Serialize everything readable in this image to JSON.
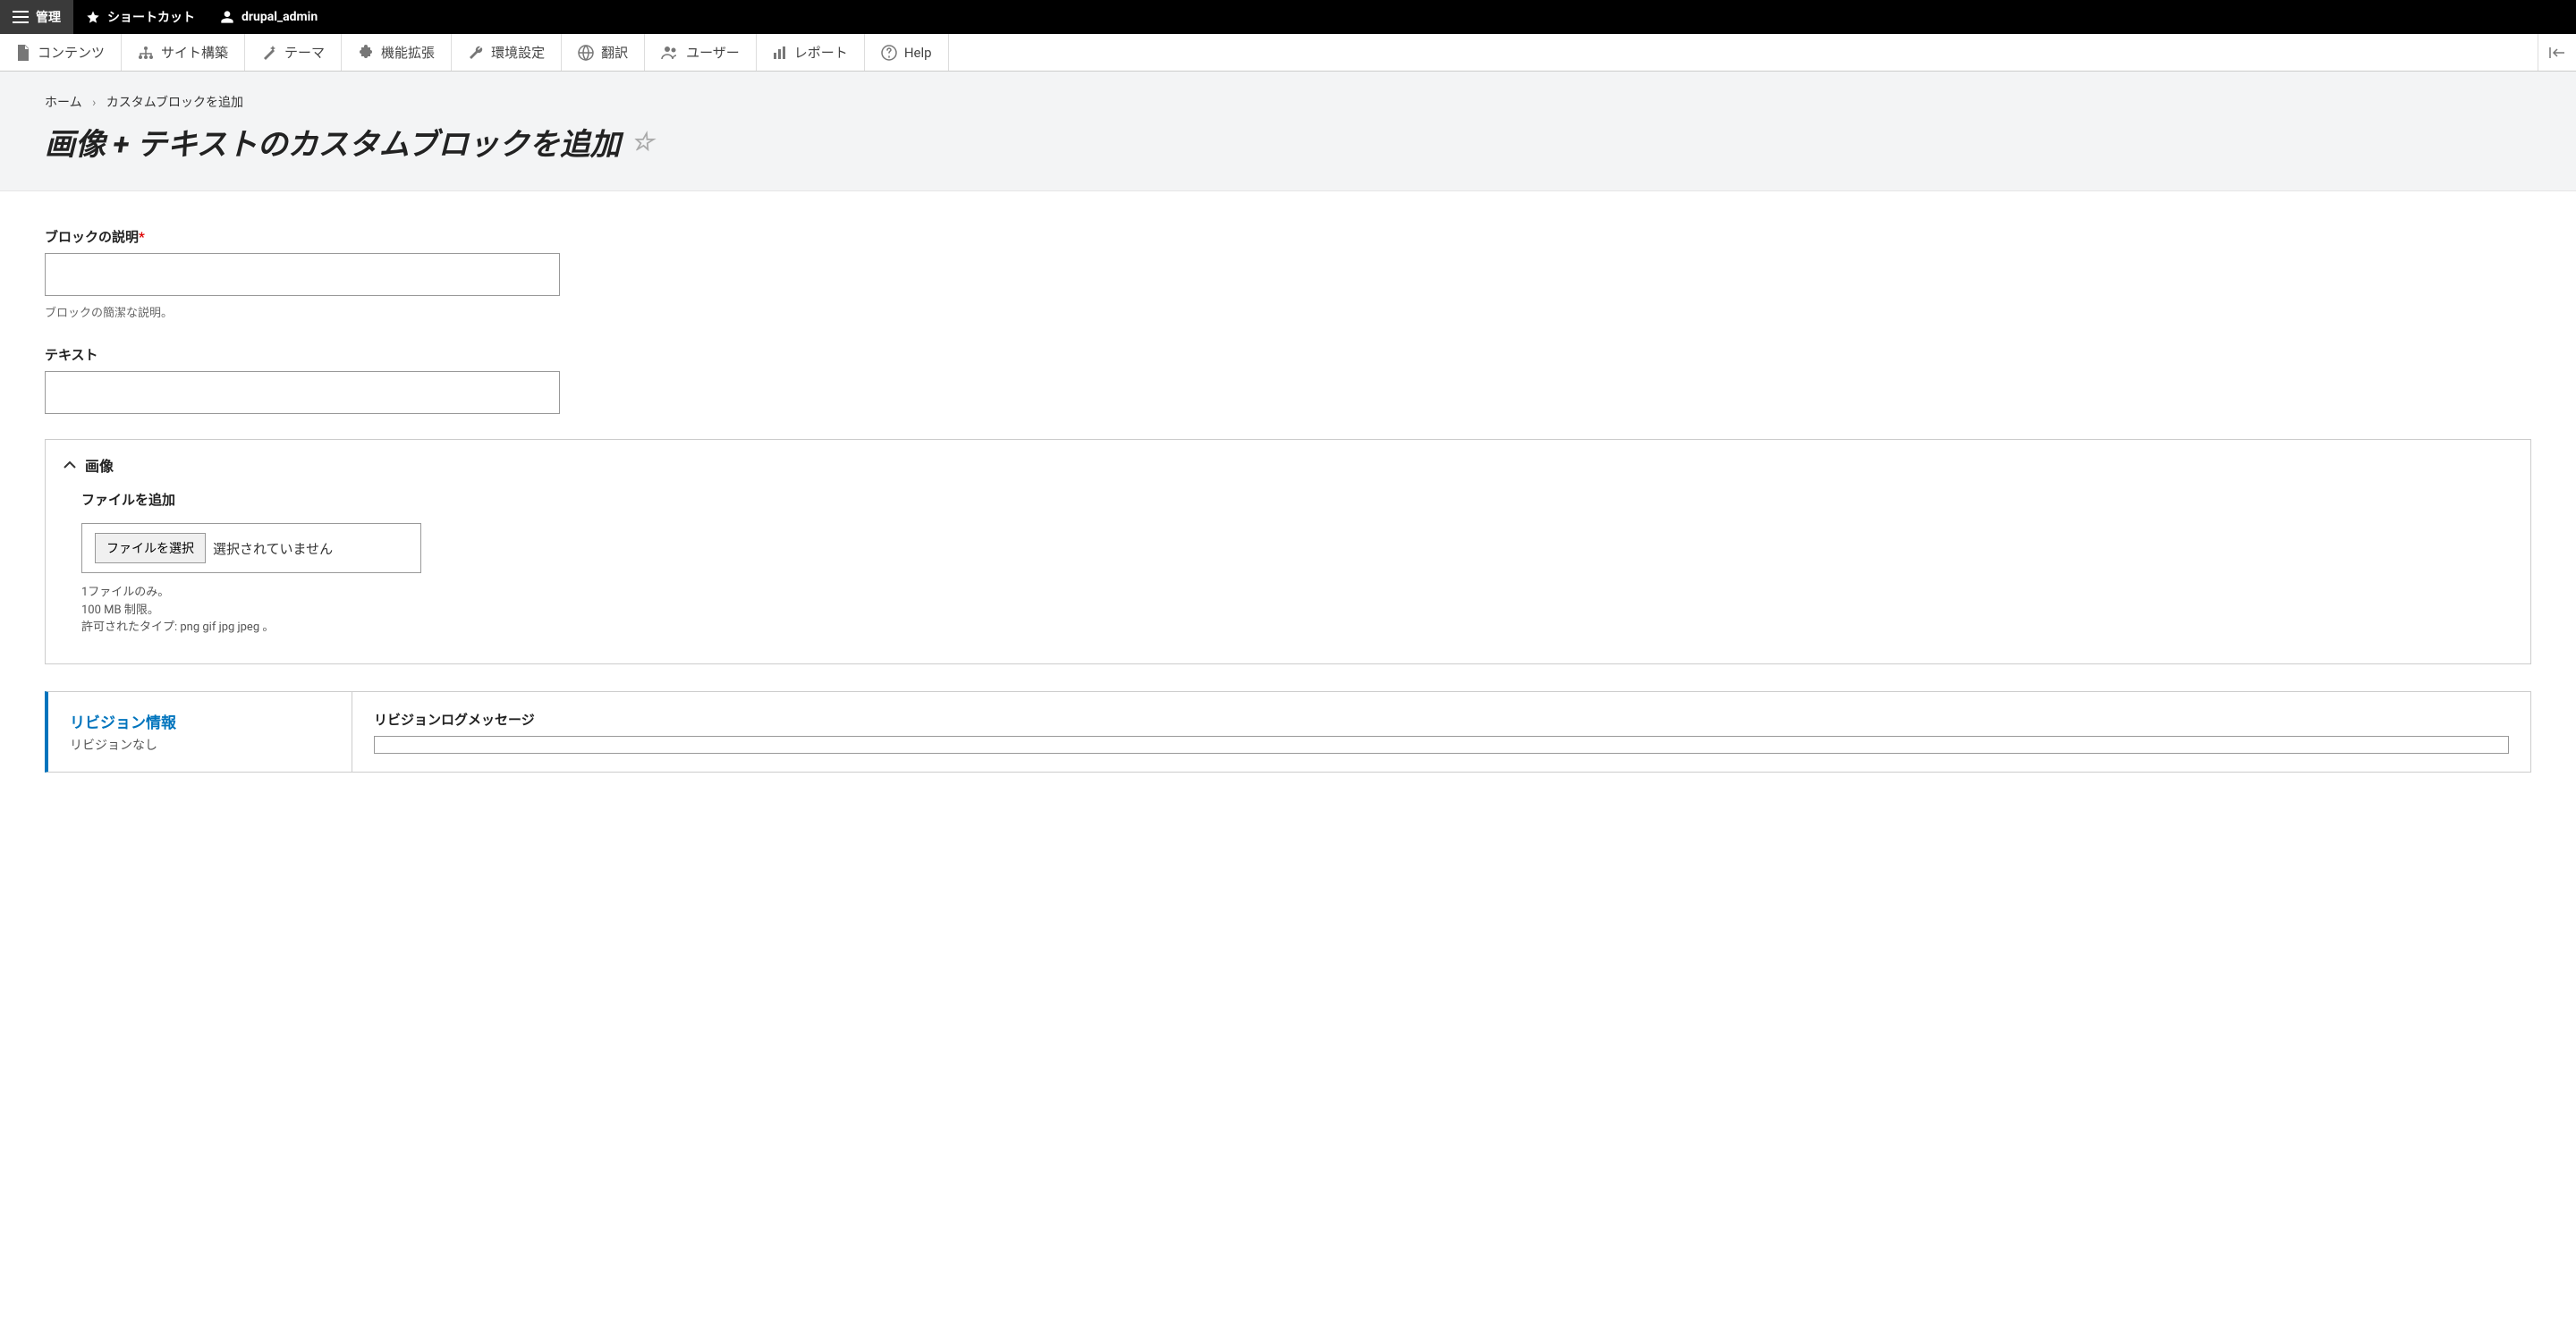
{
  "topbar": {
    "manage": "管理",
    "shortcuts": "ショートカット",
    "user": "drupal_admin"
  },
  "adminbar": {
    "content": "コンテンツ",
    "structure": "サイト構築",
    "appearance": "テーマ",
    "extend": "機能拡張",
    "configuration": "環境設定",
    "translate": "翻訳",
    "people": "ユーザー",
    "reports": "レポート",
    "help": "Help"
  },
  "breadcrumb": {
    "home": "ホーム",
    "add_block": "カスタムブロックを追加"
  },
  "page_title": "画像 + テキストのカスタムブロックを追加",
  "form": {
    "block_desc_label": "ブロックの説明",
    "block_desc_help": "ブロックの簡潔な説明。",
    "text_label": "テキスト",
    "image_legend": "画像",
    "add_file_label": "ファイルを追加",
    "choose_file_button": "ファイルを選択",
    "no_file_selected": "選択されていません",
    "file_hint_1": "1ファイルのみ。",
    "file_hint_2": "100 MB 制限。",
    "file_hint_3": "許可されたタイプ: png gif jpg jpeg 。"
  },
  "revision": {
    "title": "リビジョン情報",
    "subtitle": "リビジョンなし",
    "log_label": "リビジョンログメッセージ"
  }
}
